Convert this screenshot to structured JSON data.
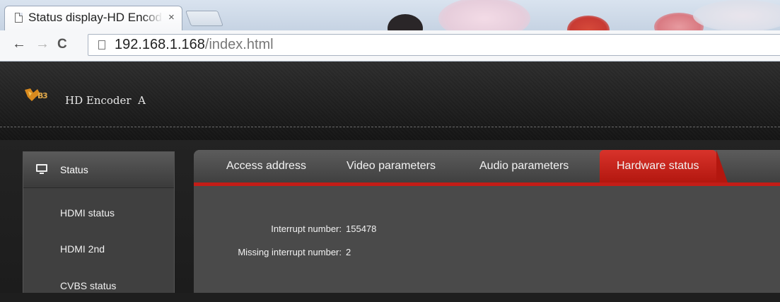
{
  "browser": {
    "tab_title": "Status display-HD Encoder",
    "tab_close": "×",
    "url_host": "192.168.1.168",
    "url_path": "/index.html",
    "back_glyph": "←",
    "forward_glyph": "→",
    "reload_glyph": "C"
  },
  "header": {
    "device_name": "HD Encoder  A"
  },
  "sidebar": {
    "title": "Status",
    "items": [
      {
        "label": "HDMI status"
      },
      {
        "label": "HDMI 2nd"
      },
      {
        "label": "CVBS status"
      }
    ]
  },
  "tabs": [
    {
      "label": "Access address"
    },
    {
      "label": "Video parameters"
    },
    {
      "label": "Audio parameters"
    },
    {
      "label": "Hardware status",
      "active": true
    }
  ],
  "hardware": {
    "rows": [
      {
        "label": "Interrupt number:",
        "value": "155478"
      },
      {
        "label": "Missing interrupt number:",
        "value": "2"
      }
    ]
  },
  "colors": {
    "accent": "#c31d17",
    "header_bg": "#1a1a1a",
    "panel_bg": "#4a4a4a",
    "sidebar_bg": "#404040"
  }
}
